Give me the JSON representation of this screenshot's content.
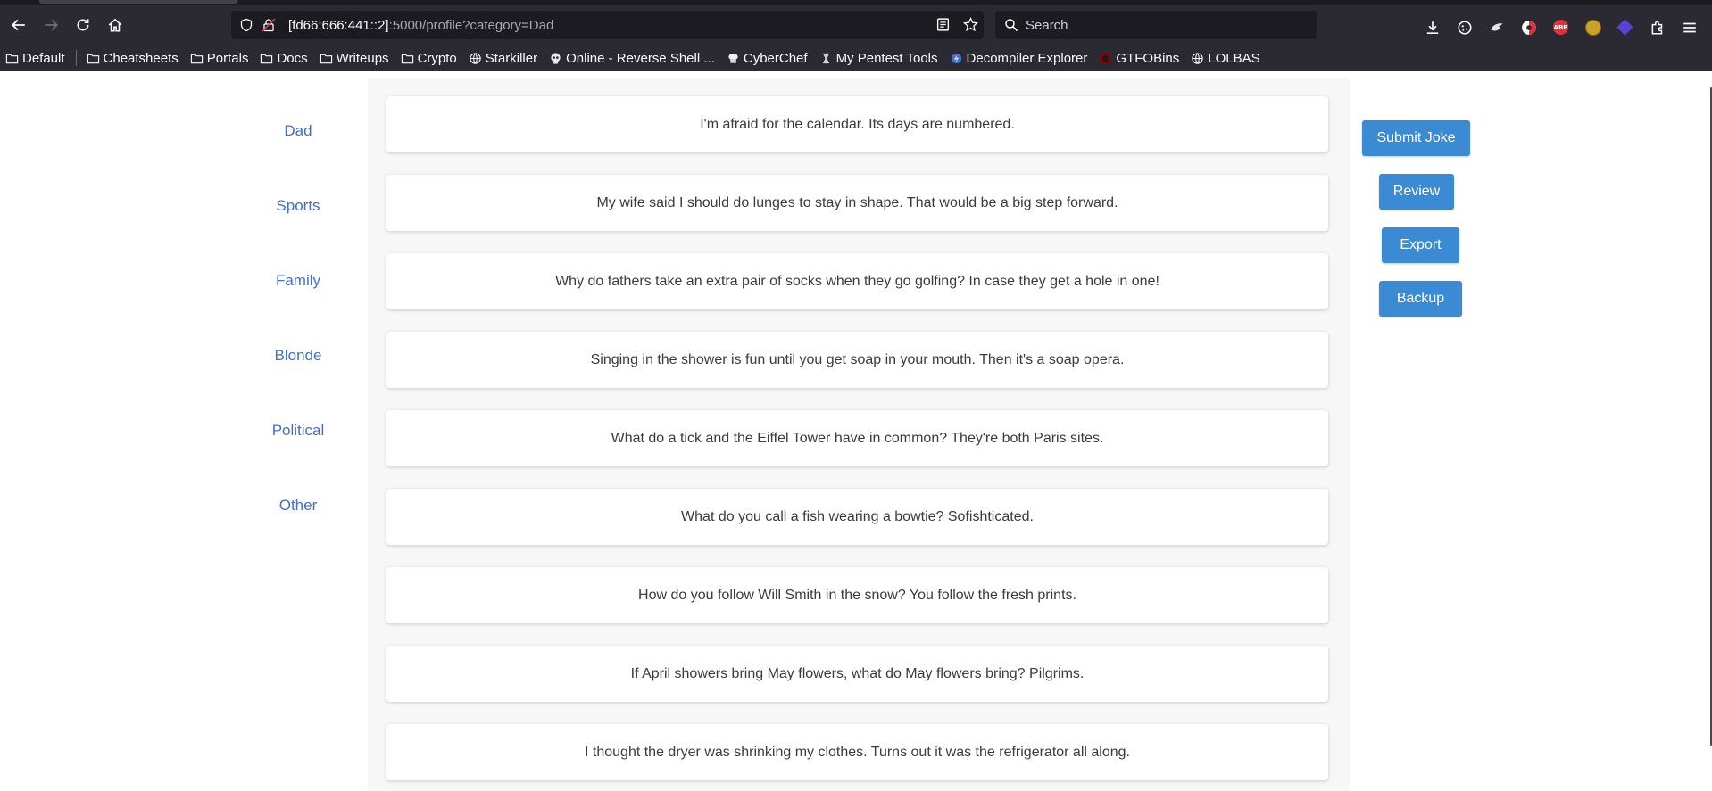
{
  "browser": {
    "url_host": "[fd66:666:441::2]",
    "url_rest": ":5000/profile?category=Dad",
    "search_placeholder": "Search",
    "abp_label": "ABP",
    "bookmarks": [
      {
        "label": "Default",
        "icon": "folder-icon"
      },
      {
        "label": "Cheatsheets",
        "icon": "folder-icon"
      },
      {
        "label": "Portals",
        "icon": "folder-icon"
      },
      {
        "label": "Docs",
        "icon": "folder-icon"
      },
      {
        "label": "Writeups",
        "icon": "folder-icon"
      },
      {
        "label": "Crypto",
        "icon": "folder-icon"
      },
      {
        "label": "Starkiller",
        "icon": "globe-icon"
      },
      {
        "label": "Online - Reverse Shell ...",
        "icon": "skull-icon"
      },
      {
        "label": "CyberChef",
        "icon": "chef-icon"
      },
      {
        "label": "My Pentest Tools",
        "icon": "tools-icon"
      },
      {
        "label": "Decompiler Explorer",
        "icon": "dogbolt-icon"
      },
      {
        "label": "GTFOBins",
        "icon": "gtfobins-icon"
      },
      {
        "label": "LOLBAS",
        "icon": "globe-icon"
      }
    ]
  },
  "categories": [
    "Dad",
    "Sports",
    "Family",
    "Blonde",
    "Political",
    "Other"
  ],
  "jokes": [
    "I'm afraid for the calendar. Its days are numbered.",
    "My wife said I should do lunges to stay in shape. That would be a big step forward.",
    "Why do fathers take an extra pair of socks when they go golfing? In case they get a hole in one!",
    "Singing in the shower is fun until you get soap in your mouth. Then it's a soap opera.",
    "What do a tick and the Eiffel Tower have in common? They're both Paris sites.",
    "What do you call a fish wearing a bowtie? Sofishticated.",
    "How do you follow Will Smith in the snow? You follow the fresh prints.",
    "If April showers bring May flowers, what do May flowers bring? Pilgrims.",
    "I thought the dryer was shrinking my clothes. Turns out it was the refrigerator all along."
  ],
  "actions": {
    "submit_joke": "Submit Joke",
    "review": "Review",
    "export": "Export",
    "backup": "Backup"
  },
  "colors": {
    "accent_button": "#3a8ad4",
    "category_link": "#3f6fd0",
    "chrome_bg": "#2b2a33"
  }
}
